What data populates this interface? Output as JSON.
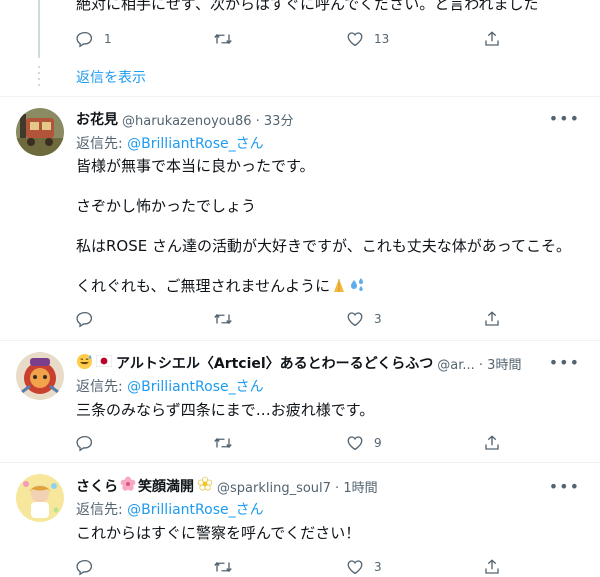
{
  "top_tweet": {
    "text": "絶対に相手にせず、次からはすぐに呼んでください。と言われました",
    "reply_count": "1",
    "retweet_count": "",
    "like_count": "13",
    "show_replies": "返信を表示"
  },
  "tweets": [
    {
      "name": "お花見",
      "meta": "@harukazenoyou86 · 33分",
      "reply_prefix": "返信先: ",
      "reply_to": "@BrilliantRose_さん",
      "lines": [
        "皆様が無事で本当に良かったです。",
        "さぞかし怖かったでしょう",
        "私はROSE さん達の活動が大好きですが、これも丈夫な体があってこそ。",
        "くれぐれも、ご無理されませんように"
      ],
      "reply_count": "",
      "retweet_count": "",
      "like_count": "3"
    },
    {
      "name": "アルトシエル〈Artciel〉あるとわーるどくらふつ",
      "meta": "@ar... · 3時間",
      "reply_prefix": "返信先: ",
      "reply_to": "@BrilliantRose_さん",
      "lines": [
        "三条のみならず四条にまで…お疲れ様です。"
      ],
      "reply_count": "",
      "retweet_count": "",
      "like_count": "9"
    },
    {
      "name": "さくら",
      "name_suffix": "笑顔満開",
      "meta": "@sparkling_soul7 · 1時間",
      "reply_prefix": "返信先: ",
      "reply_to": "@BrilliantRose_さん",
      "lines": [
        "これからはすぐに警察を呼んでください！"
      ],
      "reply_count": "",
      "retweet_count": "",
      "like_count": "3"
    }
  ],
  "icons": [
    "reply-icon",
    "retweet-icon",
    "like-icon",
    "share-icon",
    "more-icon"
  ],
  "colors": {
    "accent": "#1d9bf0",
    "secondary_text": "#536471",
    "divider": "#eff3f4"
  }
}
